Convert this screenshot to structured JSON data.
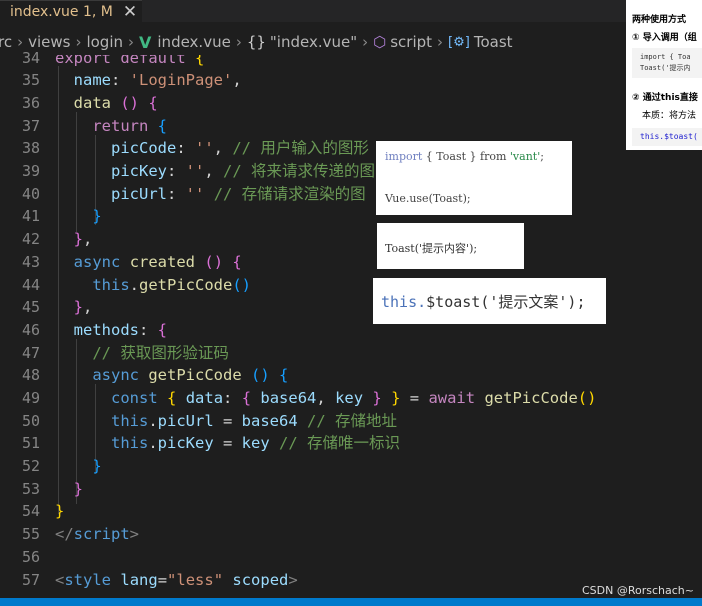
{
  "tab": {
    "label": "index.vue 1, M"
  },
  "breadcrumb": {
    "items": [
      "rc",
      "views",
      "login",
      "index.vue",
      "\"index.vue\"",
      "script",
      "Toast"
    ]
  },
  "line_numbers": [
    "34",
    "35",
    "36",
    "37",
    "38",
    "39",
    "40",
    "41",
    "42",
    "43",
    "44",
    "45",
    "46",
    "47",
    "48",
    "49",
    "50",
    "51",
    "52",
    "53",
    "54",
    "55",
    "56",
    "57"
  ],
  "code": {
    "l34_kw": "export default",
    "l35_key": "name",
    "l35_val": "'LoginPage'",
    "l36_fn": "data",
    "l37_kw": "return",
    "l38_key": "picCode",
    "l38_val": "''",
    "l38_cm": "// 用户输入的图形",
    "l39_key": "picKey",
    "l39_val": "''",
    "l39_cm": "// 将来请求传递的图",
    "l40_key": "picUrl",
    "l40_val": "''",
    "l40_cm": "// 存储请求渲染的图",
    "l43_kw": "async",
    "l43_fn": "created",
    "l44_this": "this",
    "l44_fn": "getPicCode",
    "l46_key": "methods",
    "l47_cm": "// 获取图形验证码",
    "l48_kw": "async",
    "l48_fn": "getPicCode",
    "l49_const": "const",
    "l49_data": "data",
    "l49_base64": "base64",
    "l49_key": "key",
    "l49_await": "await",
    "l49_fn": "getPicCode",
    "l50_this": "this",
    "l50_prop": "picUrl",
    "l50_val": "base64",
    "l50_cm": "// 存储地址",
    "l51_this": "this",
    "l51_prop": "picKey",
    "l51_val": "key",
    "l51_cm": "// 存储唯一标识",
    "l55_tag": "script",
    "l57_tag": "style",
    "l57_attr": "lang",
    "l57_attrval": "\"less\"",
    "l57_scoped": "scoped"
  },
  "reference": {
    "title": "两种使用方式",
    "step1": "① 导入调用（组",
    "code1a": "import { Toa",
    "code1b": "Toast('提示内",
    "step2": "② 通过this直接",
    "note": "本质：将方法",
    "code2": "this.$toast("
  },
  "cards": {
    "import_kw": "import",
    "import_mid": "{ Toast } from",
    "import_src": "'vant'",
    "use_line": "Vue.use(Toast);",
    "toast_call": "Toast('提示内容');",
    "this_kw": "this.",
    "this_rest": "$toast('提示文案');"
  },
  "watermark": "CSDN @Rorschach~",
  "colors": {
    "editor_bg": "#1e1e1e",
    "keyword": "#c586c0",
    "string": "#ce9178",
    "comment": "#6a9955",
    "property": "#9cdcfe",
    "function": "#dcdcaa",
    "status_bar": "#007acc"
  }
}
